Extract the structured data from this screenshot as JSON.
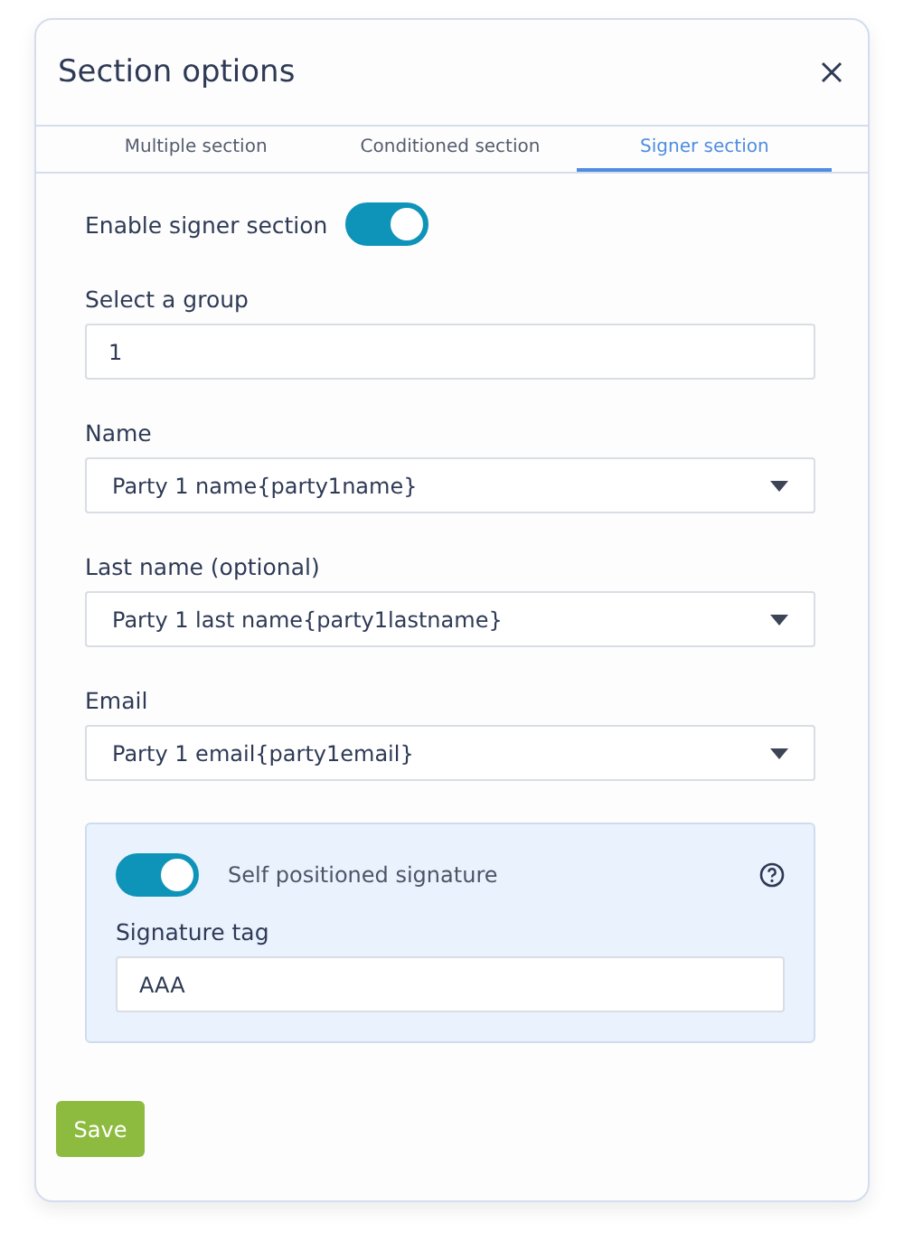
{
  "dialog": {
    "title": "Section options"
  },
  "tabs": [
    {
      "label": "Multiple section",
      "selected": false
    },
    {
      "label": "Conditioned section",
      "selected": false
    },
    {
      "label": "Signer section",
      "selected": true
    }
  ],
  "enable_signer": {
    "label": "Enable signer section",
    "on": true
  },
  "fields": [
    {
      "kind": "text",
      "label": "Select a group",
      "value": "1"
    },
    {
      "kind": "select",
      "label": "Name",
      "value": "Party 1 name{party1name}"
    },
    {
      "kind": "select",
      "label": "Last name (optional)",
      "value": "Party 1 last name{party1lastname}"
    },
    {
      "kind": "select",
      "label": "Email",
      "value": "Party 1 email{party1email}"
    }
  ],
  "signature_panel": {
    "toggle": {
      "label": "Self positioned signature",
      "on": true
    },
    "tag_label": "Signature tag",
    "tag_value": "AAA"
  },
  "buttons": [
    "Save"
  ]
}
